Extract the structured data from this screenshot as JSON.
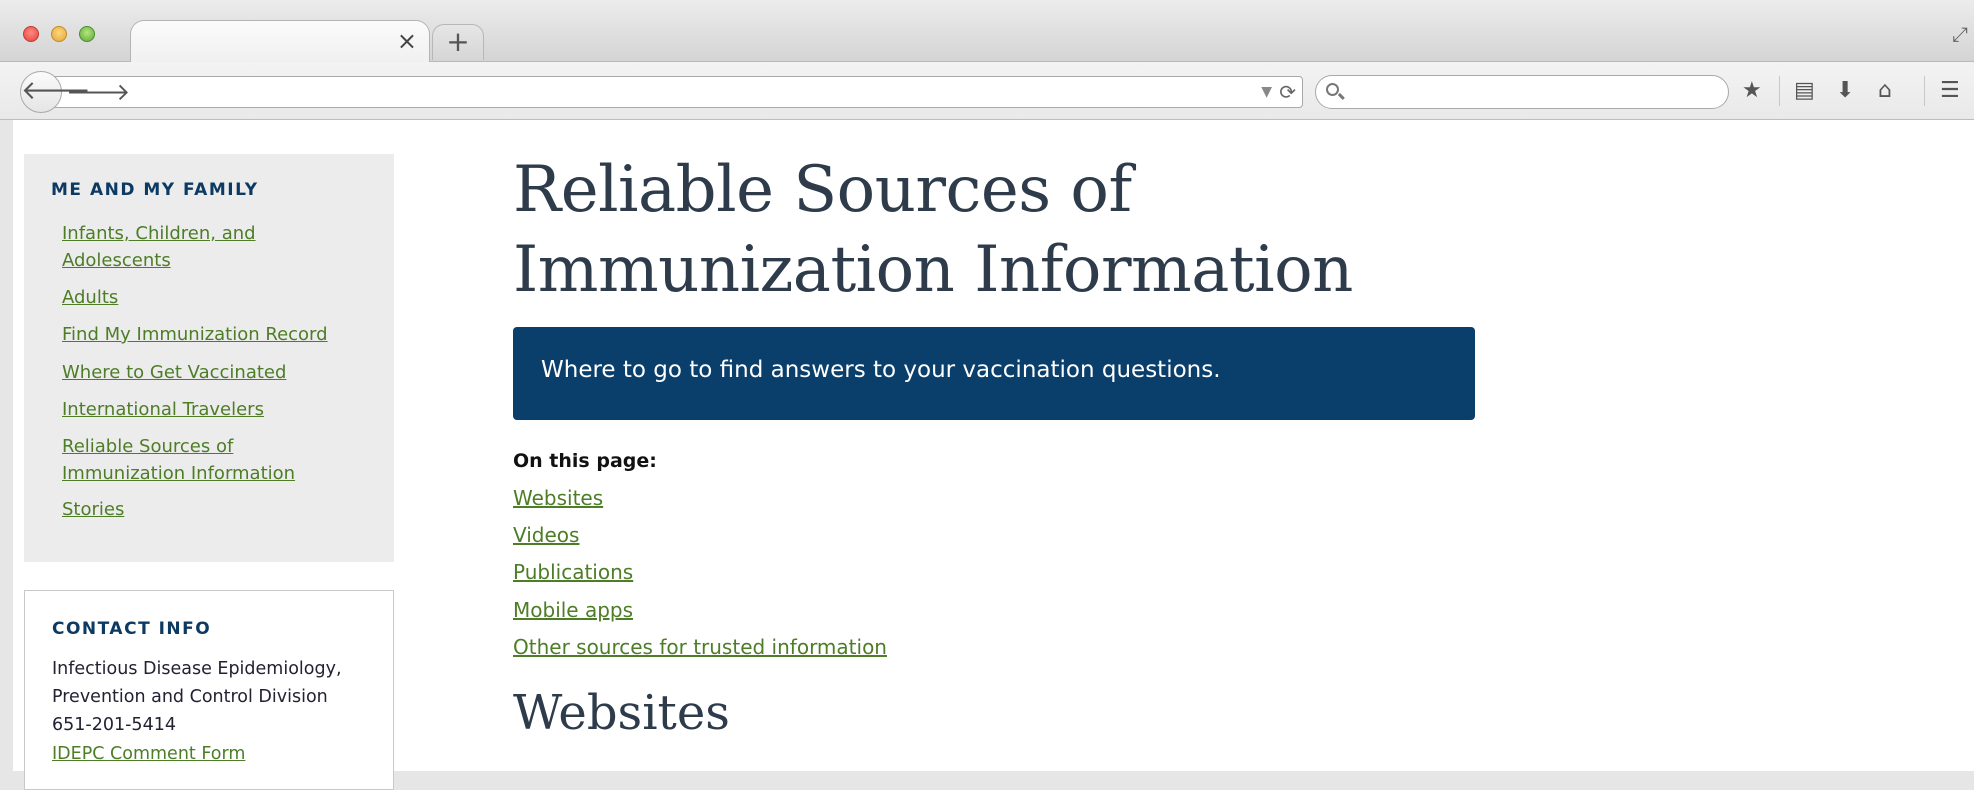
{
  "browser": {
    "tab_close": "×",
    "new_tab": "+",
    "url": "",
    "search_placeholder": ""
  },
  "sidebar": {
    "heading": "ME AND MY FAMILY",
    "items": [
      {
        "line1": "Infants, Children, and",
        "line2": "Adolescents"
      },
      {
        "line1": "Adults",
        "line2": ""
      },
      {
        "line1": "Find My Immunization Record",
        "line2": ""
      },
      {
        "line1": "Where to Get Vaccinated",
        "line2": ""
      },
      {
        "line1": "International Travelers",
        "line2": ""
      },
      {
        "line1": "Reliable Sources of",
        "line2": "Immunization Information"
      },
      {
        "line1": "Stories",
        "line2": ""
      }
    ]
  },
  "contact": {
    "heading": "CONTACT INFO",
    "line1": "Infectious Disease Epidemiology,",
    "line2": "Prevention and Control Division",
    "phone": "651-201-5414",
    "link": "IDEPC Comment Form"
  },
  "main": {
    "title_line1": "Reliable Sources of",
    "title_line2": "Immunization Information",
    "banner": "Where to go to find answers to your vaccination questions.",
    "on_this_page": "On this page:",
    "links": [
      "Websites",
      "Videos",
      "Publications",
      "Mobile apps",
      "Other sources for trusted information"
    ],
    "section_heading": "Websites"
  },
  "colors": {
    "link": "#4d7d27",
    "heading_navy": "#0d3a63",
    "banner_bg": "#0a3e6b",
    "title": "#2e3b4b"
  },
  "icons": [
    "close-window-icon",
    "minimize-icon",
    "zoom-icon",
    "tab-close-icon",
    "new-tab-icon",
    "back-arrow-icon",
    "forward-arrow-icon",
    "dropdown-icon",
    "reload-icon",
    "search-icon",
    "bookmark-star-icon",
    "reading-list-icon",
    "downloads-icon",
    "home-icon",
    "menu-icon",
    "fullscreen-icon"
  ]
}
